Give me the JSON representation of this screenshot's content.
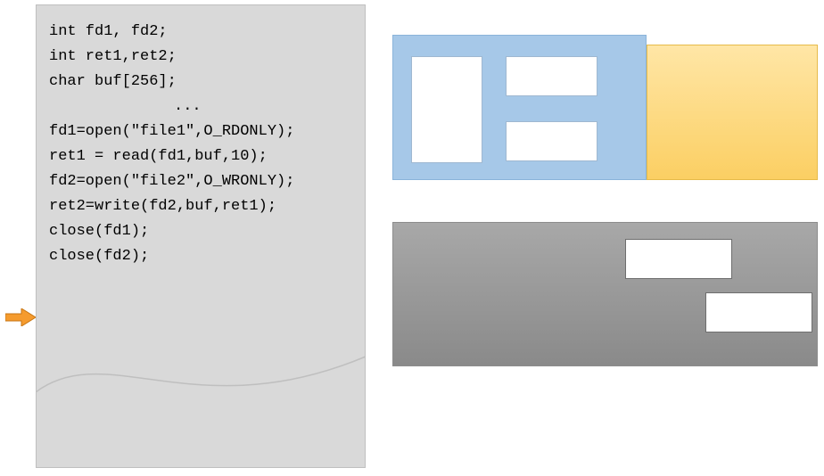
{
  "code": {
    "l1": "int fd1, fd2;",
    "l2": "int ret1,ret2;",
    "l3": "char buf[256];",
    "l4": "...",
    "l5": "fd1=open(\"file1\",O_RDONLY);",
    "l6": "ret1 = read(fd1,buf,10);",
    "l7": "",
    "l8": "fd2=open(\"file2\",O_WRONLY);",
    "l9": "ret2=write(fd2,buf,ret1);",
    "l10": "",
    "l11": "close(fd1);",
    "l12": "close(fd2);"
  },
  "colors": {
    "codeBg": "#d9d9d9",
    "blue": "#a6c8e8",
    "yellow": "#fbcf63",
    "grey": "#8a8a8a",
    "arrowFill": "#f59b2e",
    "arrowStroke": "#c77614"
  }
}
